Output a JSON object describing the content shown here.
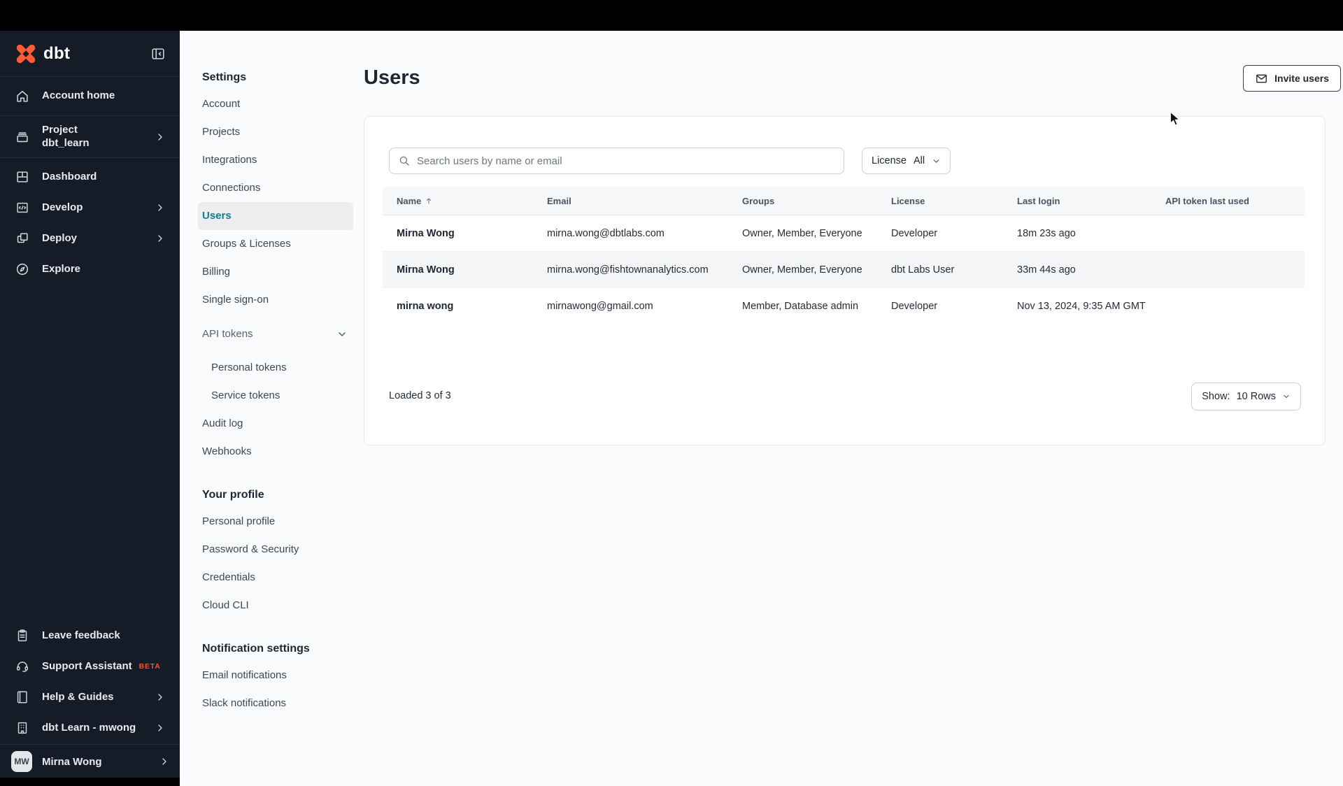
{
  "sidebar": {
    "logo_text": "dbt",
    "items_top": [
      {
        "label": "Account home"
      },
      {
        "label": "Project",
        "sublabel": "dbt_learn"
      },
      {
        "label": "Dashboard"
      },
      {
        "label": "Develop"
      },
      {
        "label": "Deploy"
      },
      {
        "label": "Explore"
      }
    ],
    "items_bottom": [
      {
        "label": "Leave feedback"
      },
      {
        "label": "Support Assistant",
        "badge": "BETA"
      },
      {
        "label": "Help & Guides"
      },
      {
        "label": "dbt Learn - mwong"
      }
    ],
    "user": {
      "initials": "MW",
      "name": "Mirna Wong"
    }
  },
  "settings_nav": {
    "title": "Settings",
    "items": [
      {
        "label": "Account"
      },
      {
        "label": "Projects"
      },
      {
        "label": "Integrations"
      },
      {
        "label": "Connections"
      },
      {
        "label": "Users"
      },
      {
        "label": "Groups & Licenses"
      },
      {
        "label": "Billing"
      },
      {
        "label": "Single sign-on"
      },
      {
        "label": "API tokens"
      },
      {
        "label": "Personal tokens"
      },
      {
        "label": "Service tokens"
      },
      {
        "label": "Audit log"
      },
      {
        "label": "Webhooks"
      }
    ],
    "profile_title": "Your profile",
    "profile_items": [
      {
        "label": "Personal profile"
      },
      {
        "label": "Password & Security"
      },
      {
        "label": "Credentials"
      },
      {
        "label": "Cloud CLI"
      }
    ],
    "notifications_title": "Notification settings",
    "notification_items": [
      {
        "label": "Email notifications"
      },
      {
        "label": "Slack notifications"
      }
    ]
  },
  "main": {
    "title": "Users",
    "invite_button_label": "Invite users",
    "search_placeholder": "Search users by name or email",
    "license_filter": {
      "label": "License",
      "value": "All"
    },
    "table": {
      "columns": [
        "Name",
        "Email",
        "Groups",
        "License",
        "Last login",
        "API token last used"
      ],
      "rows": [
        {
          "name": "Mirna Wong",
          "email": "mirna.wong@dbtlabs.com",
          "groups": "Owner, Member, Everyone",
          "license": "Developer",
          "last_login": "18m 23s ago",
          "api_token_last_used": ""
        },
        {
          "name": "Mirna Wong",
          "email": "mirna.wong@fishtownanalytics.com",
          "groups": "Owner, Member, Everyone",
          "license": "dbt Labs User",
          "last_login": "33m 44s ago",
          "api_token_last_used": ""
        },
        {
          "name": "mirna wong",
          "email": "mirnawong@gmail.com",
          "groups": "Member, Database admin",
          "license": "Developer",
          "last_login": "Nov 13, 2024, 9:35 AM GMT",
          "api_token_last_used": ""
        }
      ]
    },
    "footer": {
      "loaded_text": "Loaded 3 of 3",
      "show_label": "Show:",
      "show_value": "10 Rows"
    }
  },
  "colors": {
    "brand_orange": "#ff5c35",
    "beta_orange": "#ff4f2e",
    "active_teal": "#0e7d8a",
    "sidebar_bg": "#151b27"
  }
}
